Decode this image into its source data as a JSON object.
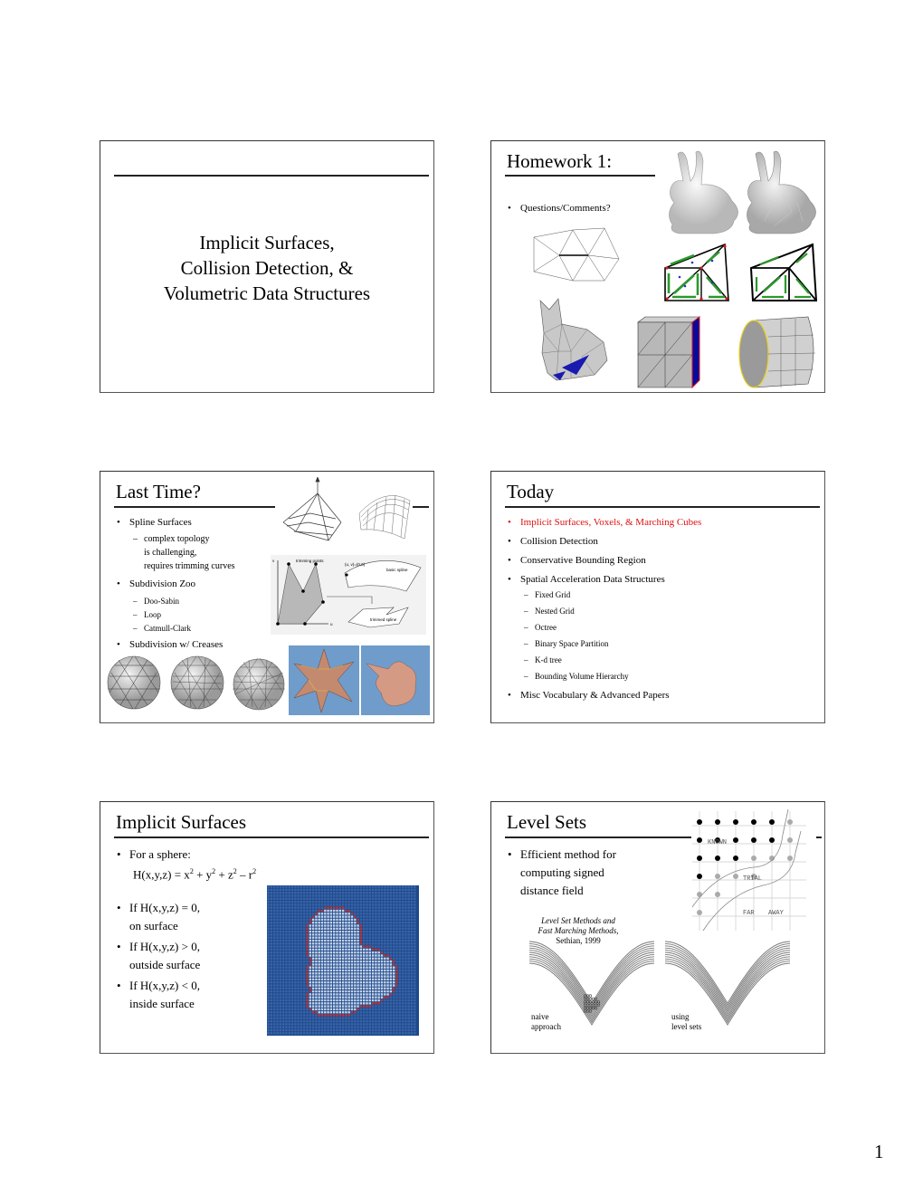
{
  "page": {
    "number": "1"
  },
  "slides": {
    "title_slide": {
      "lines": [
        "Implicit Surfaces,",
        "Collision Detection, &",
        "Volumetric Data Structures"
      ]
    },
    "homework": {
      "title": "Homework 1:",
      "bullets": [
        "Questions/Comments?"
      ],
      "images": [
        "smooth-bunny",
        "simplified-bunny",
        "triangle-mesh-diagram",
        "half-edge-diagram-1",
        "half-edge-diagram-2",
        "low-poly-bunny",
        "subdivided-cube",
        "subdivided-cylinder"
      ]
    },
    "last_time": {
      "title": "Last Time?",
      "items": [
        {
          "text": "Spline Surfaces",
          "subs": [
            "complex topology",
            "is challenging,",
            "requires trimming curves"
          ]
        },
        {
          "text": "Subdivision Zoo",
          "subs": [
            "Doo-Sabin",
            "Loop",
            "Catmull-Clark"
          ]
        },
        {
          "text": "Subdivision w/ Creases",
          "subs": []
        }
      ],
      "diagram_labels": {
        "trimming_points": "trimming points",
        "uv_origin": "(u, v)=(0,0)",
        "basic_spline": "basic spline",
        "trimmed_spline": "trimmed spline",
        "u_axis": "u",
        "v_axis": "v"
      }
    },
    "today": {
      "title": "Today",
      "items": [
        {
          "text": "Implicit Surfaces, Voxels, & Marching Cubes",
          "highlight": true,
          "color": "#e01010"
        },
        {
          "text": "Collision Detection"
        },
        {
          "text": "Conservative Bounding Region"
        },
        {
          "text": "Spatial Acceleration Data Structures"
        }
      ],
      "subitems": [
        "Fixed Grid",
        "Nested Grid",
        "Octree",
        "Binary Space Partition",
        "K-d tree",
        "Bounding Volume Hierarchy"
      ],
      "last_item": "Misc Vocabulary & Advanced Papers"
    },
    "implicit": {
      "title": "Implicit Surfaces",
      "sphere_label": "For a sphere:",
      "equation": {
        "lhs": "H(x,y,z) = x",
        "e1": "2",
        "p1": " + y",
        "e2": "2",
        "p2": " + z",
        "e3": "2",
        "p3": " –  r",
        "e4": "2"
      },
      "cases": [
        {
          "cond": "If H(x,y,z) = 0,",
          "desc": "on surface"
        },
        {
          "cond": "If H(x,y,z) > 0,",
          "desc": "outside surface"
        },
        {
          "cond": "If H(x,y,z) < 0,",
          "desc": "inside surface"
        }
      ],
      "colors": {
        "outside": "#1e4a8c",
        "boundary": "#c03838",
        "inside": "#c8d4e8"
      }
    },
    "level_sets": {
      "title": "Level Sets",
      "bullet": [
        "Efficient method for",
        "computing signed",
        "distance field"
      ],
      "citation": [
        "Level Set Methods and",
        "Fast Marching Methods,",
        "Sethian, 1999"
      ],
      "grid_labels": {
        "known": "KNOWN",
        "trial": "TRIAL",
        "far": "FAR",
        "away": "AWAY"
      },
      "captions": {
        "naive": [
          "naive",
          "approach"
        ],
        "level": [
          "using",
          "level sets"
        ]
      }
    }
  }
}
